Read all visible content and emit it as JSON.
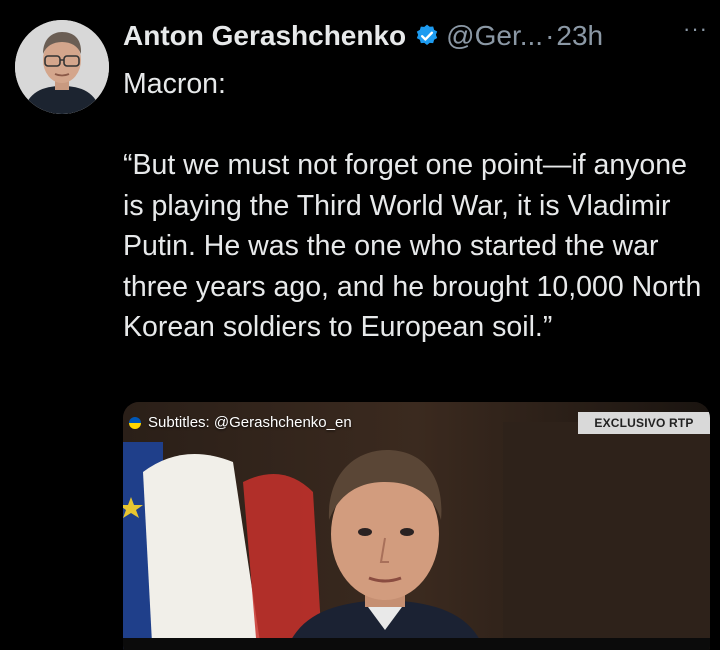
{
  "tweet": {
    "author": {
      "display_name": "Anton Gerashchenko",
      "handle": "@Ger...",
      "separator": "·",
      "time": "23h",
      "verified": true,
      "avatar_icon": "profile-photo"
    },
    "more_label": "···",
    "text": "Macron:\n\n“But we must not forget one point—if anyone is playing the Third World War, it is Vladimir Putin. He was the one who started the war three years ago, and he brought 10,000 North Korean soldiers to European soil.”"
  },
  "media": {
    "subtitle_tag": "Subtitles: @Gerashchenko_en",
    "badge": "EXCLUSIVO RTP",
    "subtitle_flag_icon": "ukraine-flag-icon"
  },
  "colors": {
    "background": "#000000",
    "text": "#e7e9ea",
    "secondary": "#8b98a5",
    "verified_blue": "#1d9bf0"
  }
}
